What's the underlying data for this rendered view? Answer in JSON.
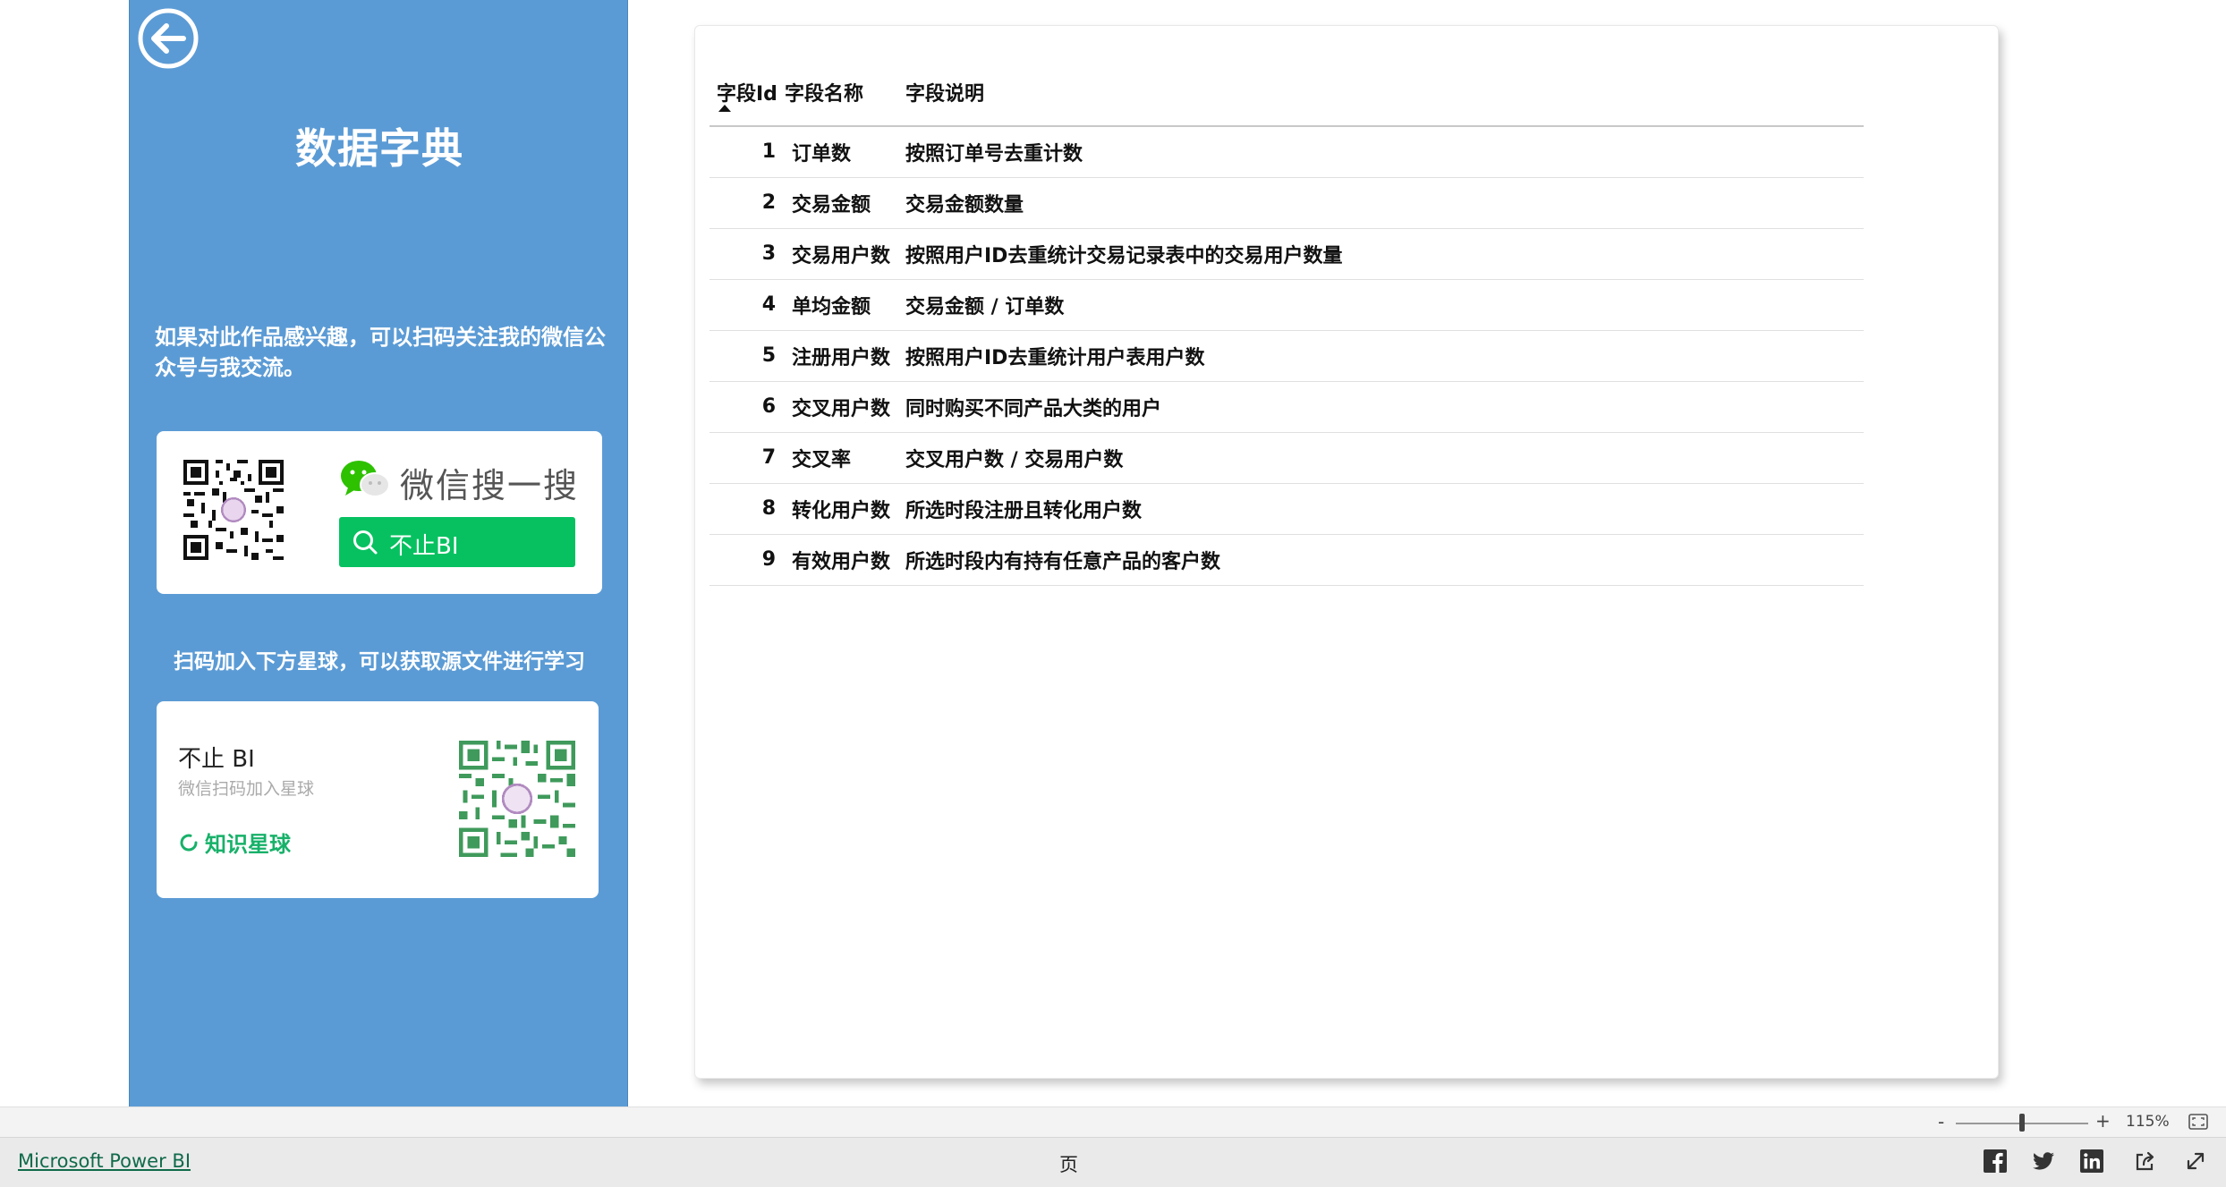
{
  "sidebar": {
    "title": "数据字典",
    "intro": "如果对此作品感兴趣，可以扫码关注我的微信公众号与我交流。",
    "wechat": {
      "search_text": "微信搜一搜",
      "button_label": "不止BI"
    },
    "planet_intro": "扫码加入下方星球，可以获取源文件进行学习",
    "planet": {
      "name": "不止 BI",
      "subtitle": "微信扫码加入星球",
      "brand": "知识星球"
    }
  },
  "table": {
    "headers": [
      "字段Id",
      "字段名称",
      "字段说明"
    ],
    "sort_column": "字段Id",
    "sort_direction": "ascending",
    "rows": [
      {
        "id": "1",
        "name": "订单数",
        "desc": "按照订单号去重计数"
      },
      {
        "id": "2",
        "name": "交易金额",
        "desc": "交易金额数量"
      },
      {
        "id": "3",
        "name": "交易用户数",
        "desc": "按照用户ID去重统计交易记录表中的交易用户数量"
      },
      {
        "id": "4",
        "name": "单均金额",
        "desc": "交易金额 / 订单数"
      },
      {
        "id": "5",
        "name": "注册用户数",
        "desc": "按照用户ID去重统计用户表用户数"
      },
      {
        "id": "6",
        "name": "交叉用户数",
        "desc": "同时购买不同产品大类的用户"
      },
      {
        "id": "7",
        "name": "交叉率",
        "desc": "交叉用户数 / 交易用户数"
      },
      {
        "id": "8",
        "name": "转化用户数",
        "desc": "所选时段注册且转化用户数"
      },
      {
        "id": "9",
        "name": "有效用户数",
        "desc": "所选时段内有持有任意产品的客户数"
      }
    ]
  },
  "zoom": {
    "minus": "-",
    "plus": "+",
    "value": "115%"
  },
  "footer": {
    "brand_link": "Microsoft Power BI",
    "page_label": "页"
  },
  "colors": {
    "panel": "#5b9bd5",
    "wechat_green": "#07c160",
    "planet_green": "#17b169"
  }
}
